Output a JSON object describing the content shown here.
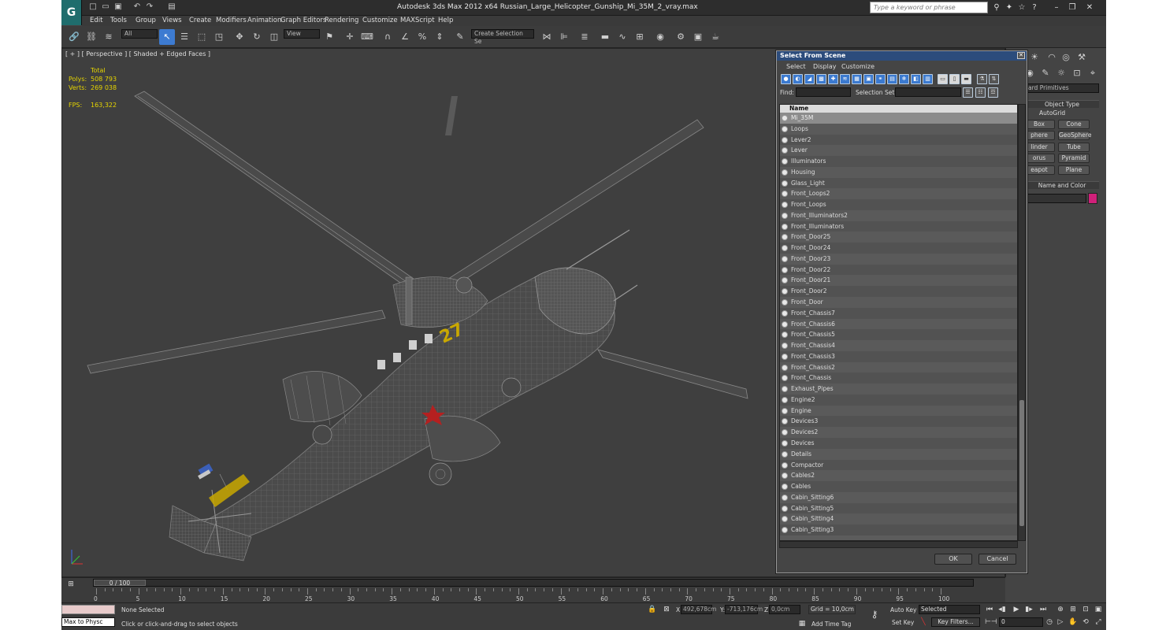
{
  "app": {
    "logo": "G",
    "title": "Autodesk 3ds Max  2012 x64     Russian_Large_Helicopter_Gunship_Mi_35M_2_vray.max",
    "search_placeholder": "Type a keyword or phrase"
  },
  "menus": [
    "Edit",
    "Tools",
    "Group",
    "Views",
    "Create",
    "Modifiers",
    "Animation",
    "Graph Editors",
    "Rendering",
    "Customize",
    "MAXScript",
    "Help"
  ],
  "toolbar": {
    "filter_value": "All",
    "refcoord_value": "View",
    "selection_set_placeholder": "Create Selection Se"
  },
  "viewport": {
    "label": "[ + ] [ Perspective ] [ Shaded + Edged Faces ]",
    "stats_header": "Total",
    "polys_label": "Polys:",
    "polys_value": "508 793",
    "verts_label": "Verts:",
    "verts_value": "269 038",
    "fps_label": "FPS:",
    "fps_value": "163,322",
    "fuselage_number": "27"
  },
  "command_panel": {
    "category": "ard Primitives",
    "object_type_header": "Object Type",
    "autogrid": "AutoGrid",
    "buttons": [
      [
        "Box",
        "Cone"
      ],
      [
        "phere",
        "GeoSphere"
      ],
      [
        "linder",
        "Tube"
      ],
      [
        "orus",
        "Pyramid"
      ],
      [
        "eapot",
        "Plane"
      ]
    ],
    "name_color_header": "Name and Color",
    "accent_color": "#d0207a"
  },
  "dialog": {
    "title": "Select From Scene",
    "menus": [
      "Select",
      "Display",
      "Customize"
    ],
    "find_label": "Find:",
    "selset_label": "Selection Set:",
    "column_name": "Name",
    "items": [
      "Mi_35M",
      "Loops",
      "Lever2",
      "Lever",
      "Illuminators",
      "Housing",
      "Glass_Light",
      "Front_Loops2",
      "Front_Loops",
      "Front_Illuminators2",
      "Front_Illuminators",
      "Front_Door25",
      "Front_Door24",
      "Front_Door23",
      "Front_Door22",
      "Front_Door21",
      "Front_Door2",
      "Front_Door",
      "Front_Chassis7",
      "Front_Chassis6",
      "Front_Chassis5",
      "Front_Chassis4",
      "Front_Chassis3",
      "Front_Chassis2",
      "Front_Chassis",
      "Exhaust_Pipes",
      "Engine2",
      "Engine",
      "Devices3",
      "Devices2",
      "Devices",
      "Details",
      "Compactor",
      "Cables2",
      "Cables",
      "Cabin_Sitting6",
      "Cabin_Sitting5",
      "Cabin_Sitting4",
      "Cabin_Sitting3"
    ],
    "ok_label": "OK",
    "cancel_label": "Cancel"
  },
  "timeline": {
    "slider_label": "0 / 100",
    "ticks": [
      "0",
      "5",
      "10",
      "15",
      "20",
      "25",
      "30",
      "35",
      "40",
      "45",
      "50",
      "55",
      "60",
      "65",
      "70",
      "75",
      "80",
      "85",
      "90",
      "95",
      "100"
    ]
  },
  "status": {
    "maxscript_label": "Max to Physc",
    "selection_status": "None Selected",
    "prompt": "Click or click-and-drag to select objects",
    "x_label": "X:",
    "x_value": "492,678cm",
    "y_label": "Y:",
    "y_value": "-713,176cm",
    "z_label": "Z:",
    "z_value": "0,0cm",
    "grid": "Grid = 10,0cm",
    "add_time_tag": "Add Time Tag",
    "auto_key": "Auto Key",
    "set_key": "Set Key",
    "key_mode_value": "Selected",
    "key_filters": "Key Filters...",
    "frame_value": "0"
  }
}
